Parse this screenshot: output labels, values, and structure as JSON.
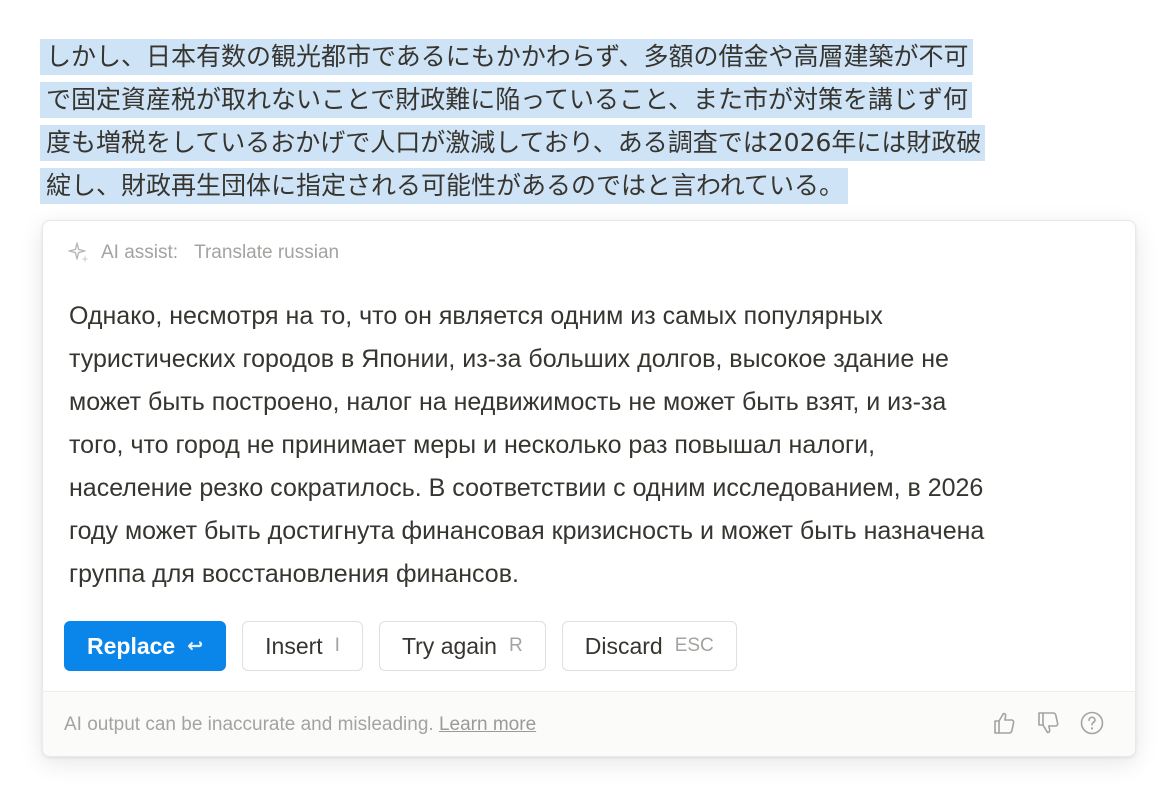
{
  "source": {
    "lines": [
      "しかし、日本有数の観光都市であるにもかかわらず、多額の借金や高層建築が不可",
      "で固定資産税が取れないことで財政難に陥っていること、また市が対策を講じず何",
      "度も増税をしているおかげで人口が激減しており、ある調査では2026年には財政破",
      "綻し、財政再生団体に指定される可能性があるのではと言われている。"
    ]
  },
  "panel": {
    "header": {
      "icon": "sparkle-icon",
      "prefix": "AI assist:",
      "command": "Translate russian"
    },
    "output_lines": [
      "Однако, несмотря на то, что он является одним из самых популярных",
      "туристических городов в Японии, из-за больших долгов, высокое здание не",
      "может быть построено, налог на недвижимость не может быть взят, и из-за",
      "того, что город не принимает меры и несколько раз повышал налоги,",
      "население резко сократилось. В соответствии с одним исследованием, в 2026",
      "году может быть достигнута финансовая кризисность и может быть назначена",
      "группа для восстановления финансов."
    ],
    "actions": {
      "replace": {
        "label": "Replace",
        "key": "↩"
      },
      "insert": {
        "label": "Insert",
        "key": "I"
      },
      "try_again": {
        "label": "Try again",
        "key": "R"
      },
      "discard": {
        "label": "Discard",
        "key": "ESC"
      }
    },
    "footer": {
      "disclaimer": "AI output can be inaccurate and misleading.",
      "learn_more": "Learn more",
      "icons": [
        "thumbs-up-icon",
        "thumbs-down-icon",
        "help-icon"
      ]
    }
  },
  "colors": {
    "selection": "#cfe3f7",
    "primary": "#0a85e9",
    "text": "#37352f",
    "muted": "#a4a3a0"
  }
}
